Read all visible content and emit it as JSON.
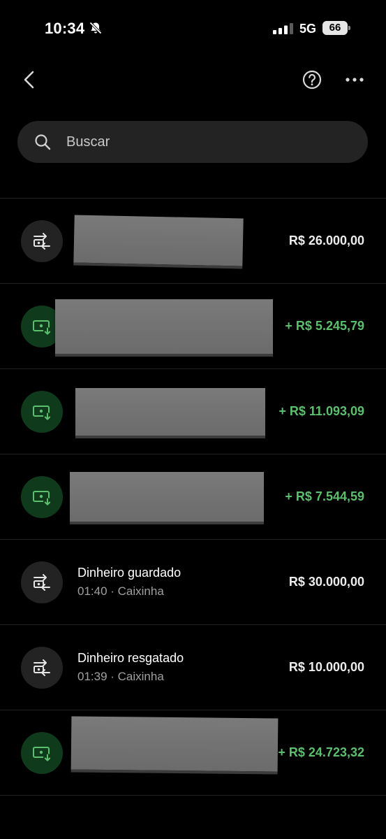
{
  "status_bar": {
    "time": "10:34",
    "network": "5G",
    "battery": "66"
  },
  "nav": {
    "back_icon": "chevron-left-icon",
    "help_icon": "question-circle-icon",
    "more_icon": "more-horizontal-icon"
  },
  "search": {
    "placeholder": "Buscar"
  },
  "transactions": [
    {
      "title": "",
      "subtitle": "",
      "amount": "R$ 26.000,00",
      "type": "neutral",
      "icon": "transfer-icon"
    },
    {
      "title": "",
      "subtitle": "",
      "amount": "+ R$ 5.245,79",
      "type": "income",
      "icon": "money-receive-icon"
    },
    {
      "title": "",
      "subtitle": "",
      "amount": "+ R$ 11.093,09",
      "type": "income",
      "icon": "money-receive-icon"
    },
    {
      "title": "",
      "subtitle": "",
      "amount": "+ R$ 7.544,59",
      "type": "income",
      "icon": "money-receive-icon"
    },
    {
      "title": "Dinheiro guardado",
      "subtitle": "01:40 · Caixinha",
      "amount": "R$ 30.000,00",
      "type": "neutral",
      "icon": "transfer-icon"
    },
    {
      "title": "Dinheiro resgatado",
      "subtitle": "01:39 · Caixinha",
      "amount": "R$ 10.000,00",
      "type": "neutral",
      "icon": "transfer-icon"
    },
    {
      "title": "",
      "subtitle": "",
      "amount": "+ R$ 24.723,32",
      "type": "income",
      "icon": "money-receive-icon"
    }
  ],
  "colors": {
    "background": "#000000",
    "income": "#5cbf6e",
    "income_circle": "#0f3a1c",
    "neutral_circle": "#232323"
  }
}
